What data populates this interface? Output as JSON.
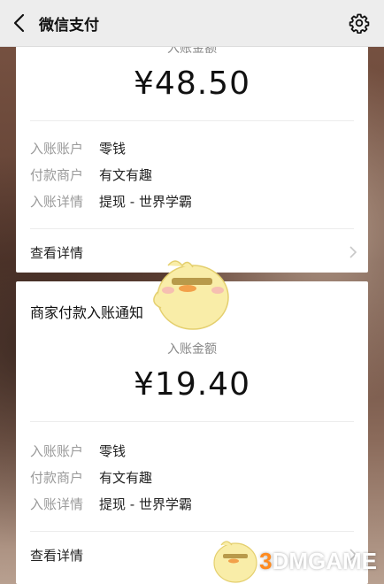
{
  "header": {
    "title": "微信支付",
    "back_icon": "chevron-left-icon",
    "settings_icon": "gear-icon"
  },
  "cards": [
    {
      "card_title": "",
      "amount_label": "入账金额",
      "amount": "¥48.50",
      "rows": [
        {
          "key": "入账账户",
          "value": "零钱"
        },
        {
          "key": "付款商户",
          "value": "有文有趣"
        },
        {
          "key": "入账详情",
          "value": "提现 - 世界学霸"
        }
      ],
      "details_label": "查看详情"
    },
    {
      "card_title": "商家付款入账通知",
      "amount_label": "入账金额",
      "amount": "¥19.40",
      "rows": [
        {
          "key": "入账账户",
          "value": "零钱"
        },
        {
          "key": "付款商户",
          "value": "有文有趣"
        },
        {
          "key": "入账详情",
          "value": "提现 - 世界学霸"
        }
      ],
      "details_label": "查看详情"
    }
  ],
  "watermark": {
    "prefix": "3",
    "text": "DMGAME"
  },
  "colors": {
    "header_bg": "#ededed",
    "card_bg": "#ffffff",
    "watermark_accent": "#ff8a1e"
  }
}
